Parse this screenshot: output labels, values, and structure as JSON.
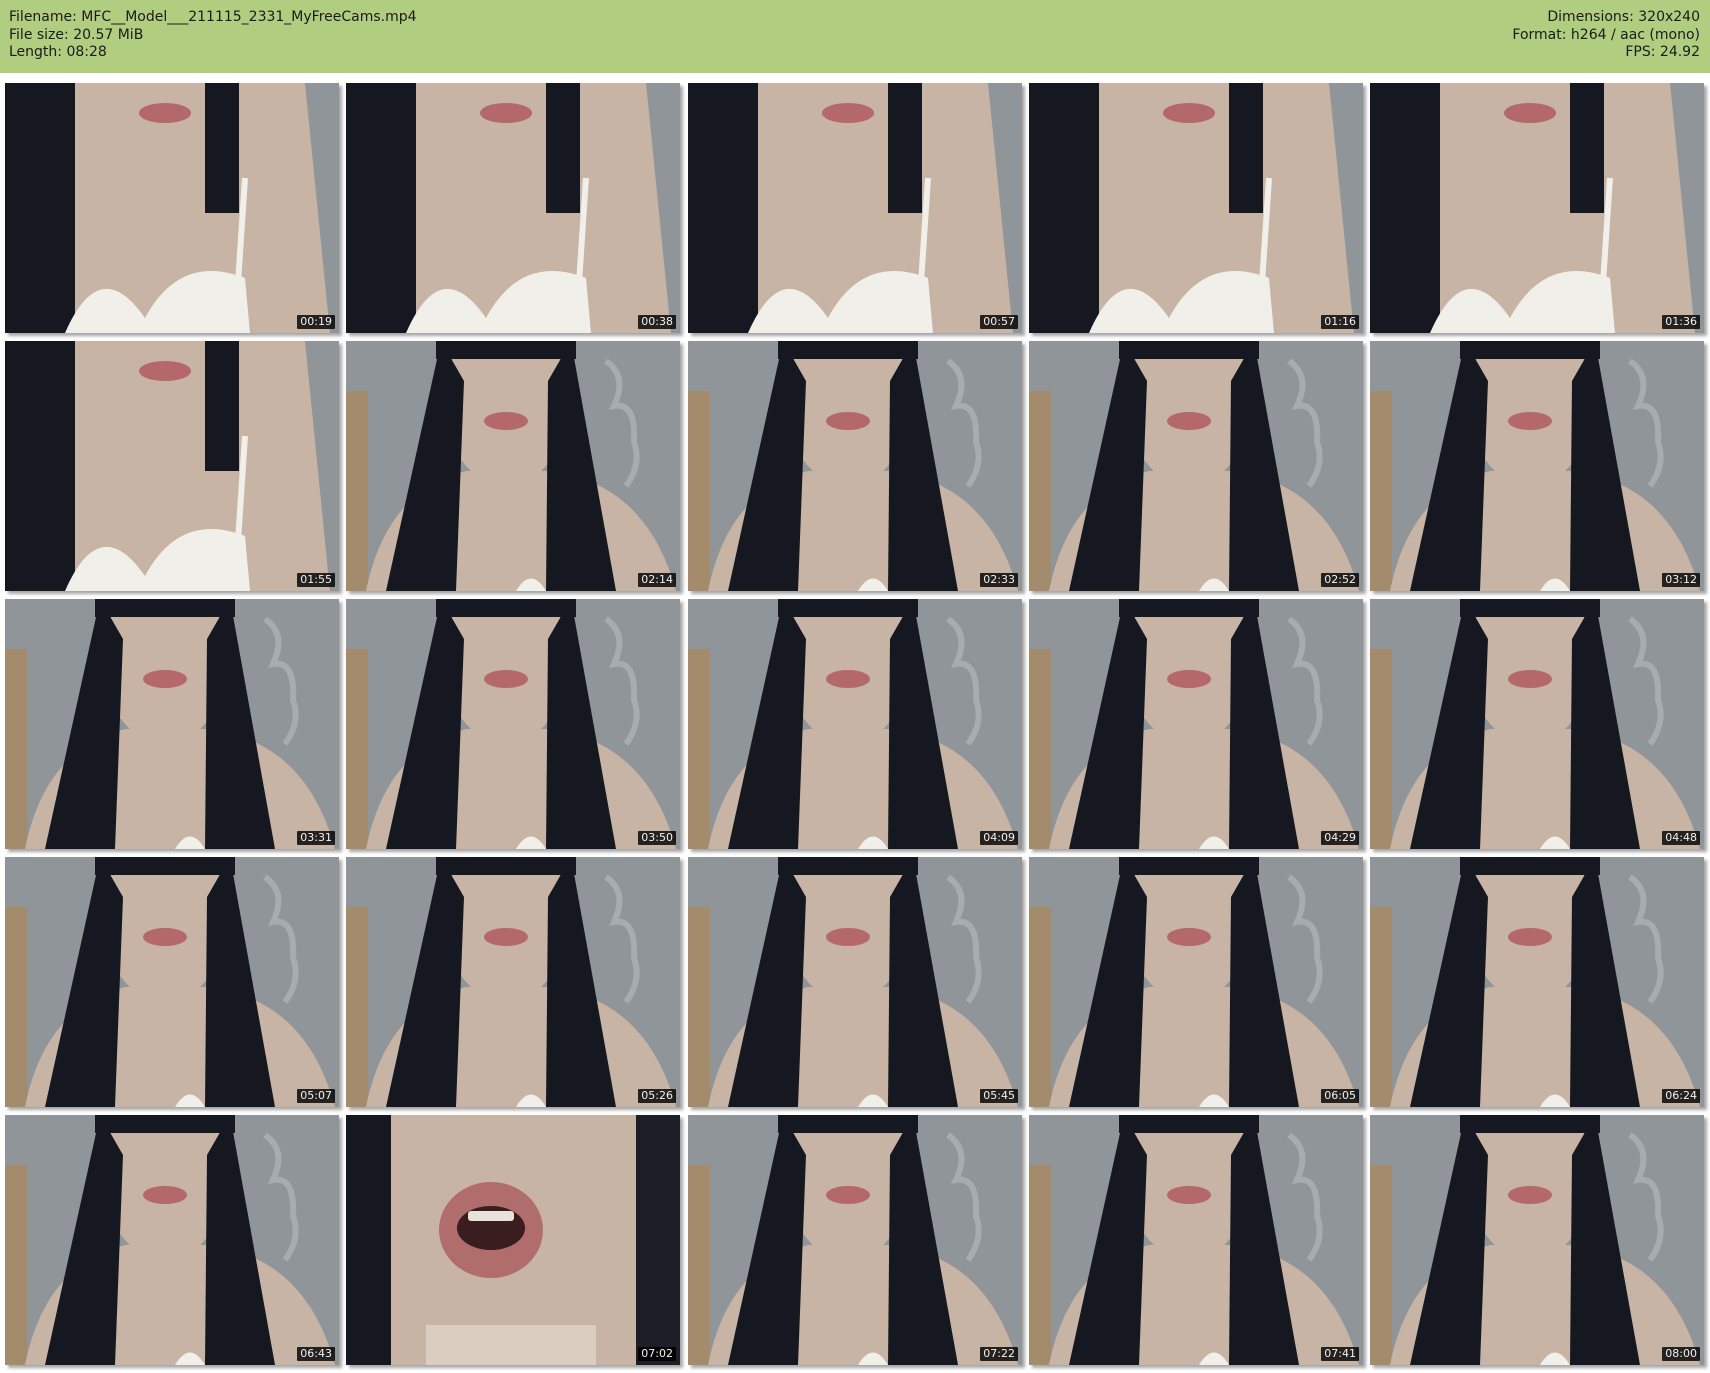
{
  "header": {
    "filename": "Filename: MFC__Model___211115_2331_MyFreeCams.mp4",
    "file_size": "File size: 20.57 MiB",
    "length": "Length: 08:28",
    "dimensions": "Dimensions: 320x240",
    "format": "Format: h264 / aac (mono)",
    "fps": "FPS: 24.92"
  },
  "colors": {
    "header_bg": "#b1cd80",
    "wall": "#8f9599",
    "skin": "#c7b4a4",
    "hair": "#151821",
    "fabric": "#f1efe9",
    "lips": "#b4686a",
    "wood": "#b0864f"
  },
  "thumbnails": [
    {
      "time": "00:19",
      "kind": "bra"
    },
    {
      "time": "00:38",
      "kind": "bra"
    },
    {
      "time": "00:57",
      "kind": "bra"
    },
    {
      "time": "01:16",
      "kind": "bra"
    },
    {
      "time": "01:36",
      "kind": "bra"
    },
    {
      "time": "01:55",
      "kind": "bra"
    },
    {
      "time": "02:14",
      "kind": "face"
    },
    {
      "time": "02:33",
      "kind": "face"
    },
    {
      "time": "02:52",
      "kind": "face"
    },
    {
      "time": "03:12",
      "kind": "face"
    },
    {
      "time": "03:31",
      "kind": "face"
    },
    {
      "time": "03:50",
      "kind": "face"
    },
    {
      "time": "04:09",
      "kind": "face"
    },
    {
      "time": "04:29",
      "kind": "face"
    },
    {
      "time": "04:48",
      "kind": "face"
    },
    {
      "time": "05:07",
      "kind": "face"
    },
    {
      "time": "05:26",
      "kind": "face"
    },
    {
      "time": "05:45",
      "kind": "face"
    },
    {
      "time": "06:05",
      "kind": "face"
    },
    {
      "time": "06:24",
      "kind": "face"
    },
    {
      "time": "06:43",
      "kind": "face"
    },
    {
      "time": "07:02",
      "kind": "mouth"
    },
    {
      "time": "07:22",
      "kind": "face"
    },
    {
      "time": "07:41",
      "kind": "face"
    },
    {
      "time": "08:00",
      "kind": "face"
    }
  ]
}
